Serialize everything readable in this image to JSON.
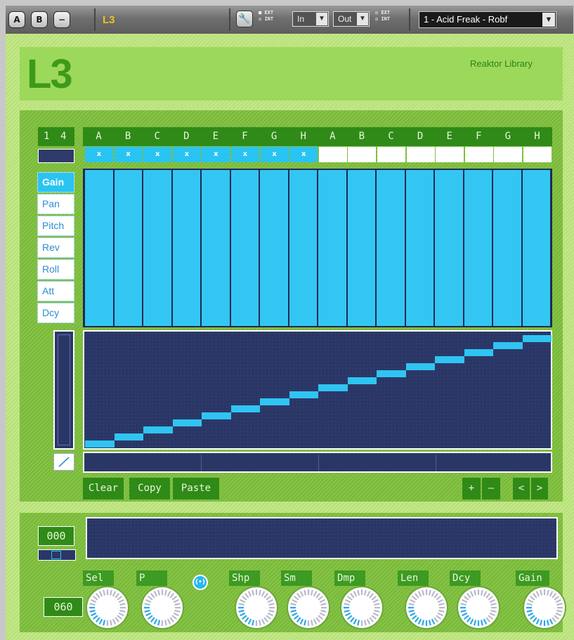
{
  "toolbar": {
    "btn_a": "A",
    "btn_b": "B",
    "btn_minus": "−",
    "title": "L3",
    "ext_label": "EXT",
    "int_label": "INT",
    "in_label": "In",
    "out_label": "Out",
    "preset": "1 - Acid Freak - Robf"
  },
  "header": {
    "title": "L3",
    "library": "Reaktor Library"
  },
  "sequencer": {
    "length_digits": [
      "1",
      "4"
    ],
    "step_letters": [
      "A",
      "B",
      "C",
      "D",
      "E",
      "F",
      "G",
      "H",
      "A",
      "B",
      "C",
      "D",
      "E",
      "F",
      "G",
      "H"
    ],
    "step_mutes": [
      true,
      true,
      true,
      true,
      true,
      true,
      true,
      true,
      false,
      false,
      false,
      false,
      false,
      false,
      false,
      false
    ],
    "mute_mark": "x",
    "lanes": [
      "Gain",
      "Pan",
      "Pitch",
      "Rev",
      "Roll",
      "Att",
      "Dcy"
    ],
    "active_lane": "Gain",
    "gain_values": [
      1,
      1,
      1,
      1,
      1,
      1,
      1,
      1,
      1,
      1,
      1,
      1,
      1,
      1,
      1,
      1
    ],
    "pitch_values": [
      0,
      1,
      2,
      3,
      4,
      5,
      6,
      7,
      8,
      9,
      10,
      11,
      12,
      13,
      14,
      15
    ],
    "buttons": {
      "clear": "Clear",
      "copy": "Copy",
      "paste": "Paste",
      "plus": "+",
      "minus": "–",
      "prev": "<",
      "next": ">"
    }
  },
  "lower": {
    "counter_top": "000",
    "counter_bottom": "060",
    "link_label": "(•)",
    "knobs": [
      {
        "label": "Sel"
      },
      {
        "label": "P"
      },
      {
        "label": "Shp"
      },
      {
        "label": "Sm"
      },
      {
        "label": "Dmp"
      },
      {
        "label": "Len"
      },
      {
        "label": "Dcy"
      },
      {
        "label": "Gain"
      }
    ]
  },
  "colors": {
    "accent": "#29c4f2",
    "panel_green": "#7ab83c",
    "dark_navy": "#2a3766",
    "header_green": "#9cd95a"
  }
}
